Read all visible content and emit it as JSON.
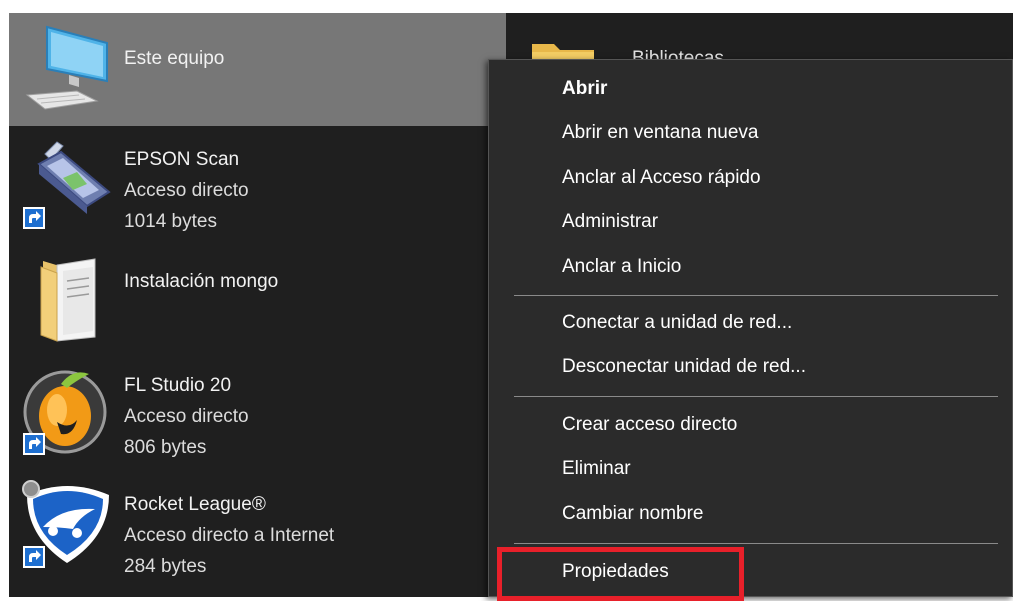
{
  "explorer": {
    "items": [
      {
        "name": "Este equipo",
        "lines": []
      },
      {
        "name": "EPSON Scan",
        "lines": [
          "Acceso directo",
          "1014 bytes"
        ]
      },
      {
        "name": "Instalación mongo",
        "lines": []
      },
      {
        "name": "FL Studio 20",
        "lines": [
          "Acceso directo",
          "806 bytes"
        ]
      },
      {
        "name": "Rocket League®",
        "lines": [
          "Acceso directo a Internet",
          "284 bytes"
        ]
      }
    ],
    "right_item": {
      "name": "Bibliotecas"
    }
  },
  "context_menu": {
    "items": [
      {
        "label": "Abrir"
      },
      {
        "label": "Abrir en ventana nueva"
      },
      {
        "label": "Anclar al Acceso rápido"
      },
      {
        "label": "Administrar"
      },
      {
        "label": "Anclar a Inicio"
      },
      {
        "label": "Conectar a unidad de red..."
      },
      {
        "label": "Desconectar unidad de red..."
      },
      {
        "label": "Crear acceso directo"
      },
      {
        "label": "Eliminar"
      },
      {
        "label": "Cambiar nombre"
      },
      {
        "label": "Propiedades"
      }
    ]
  },
  "colors": {
    "explorer_bg": "#1f1f1f",
    "selected_bg": "#777777",
    "menu_bg": "#2b2b2b",
    "highlight": "#e8202a"
  }
}
